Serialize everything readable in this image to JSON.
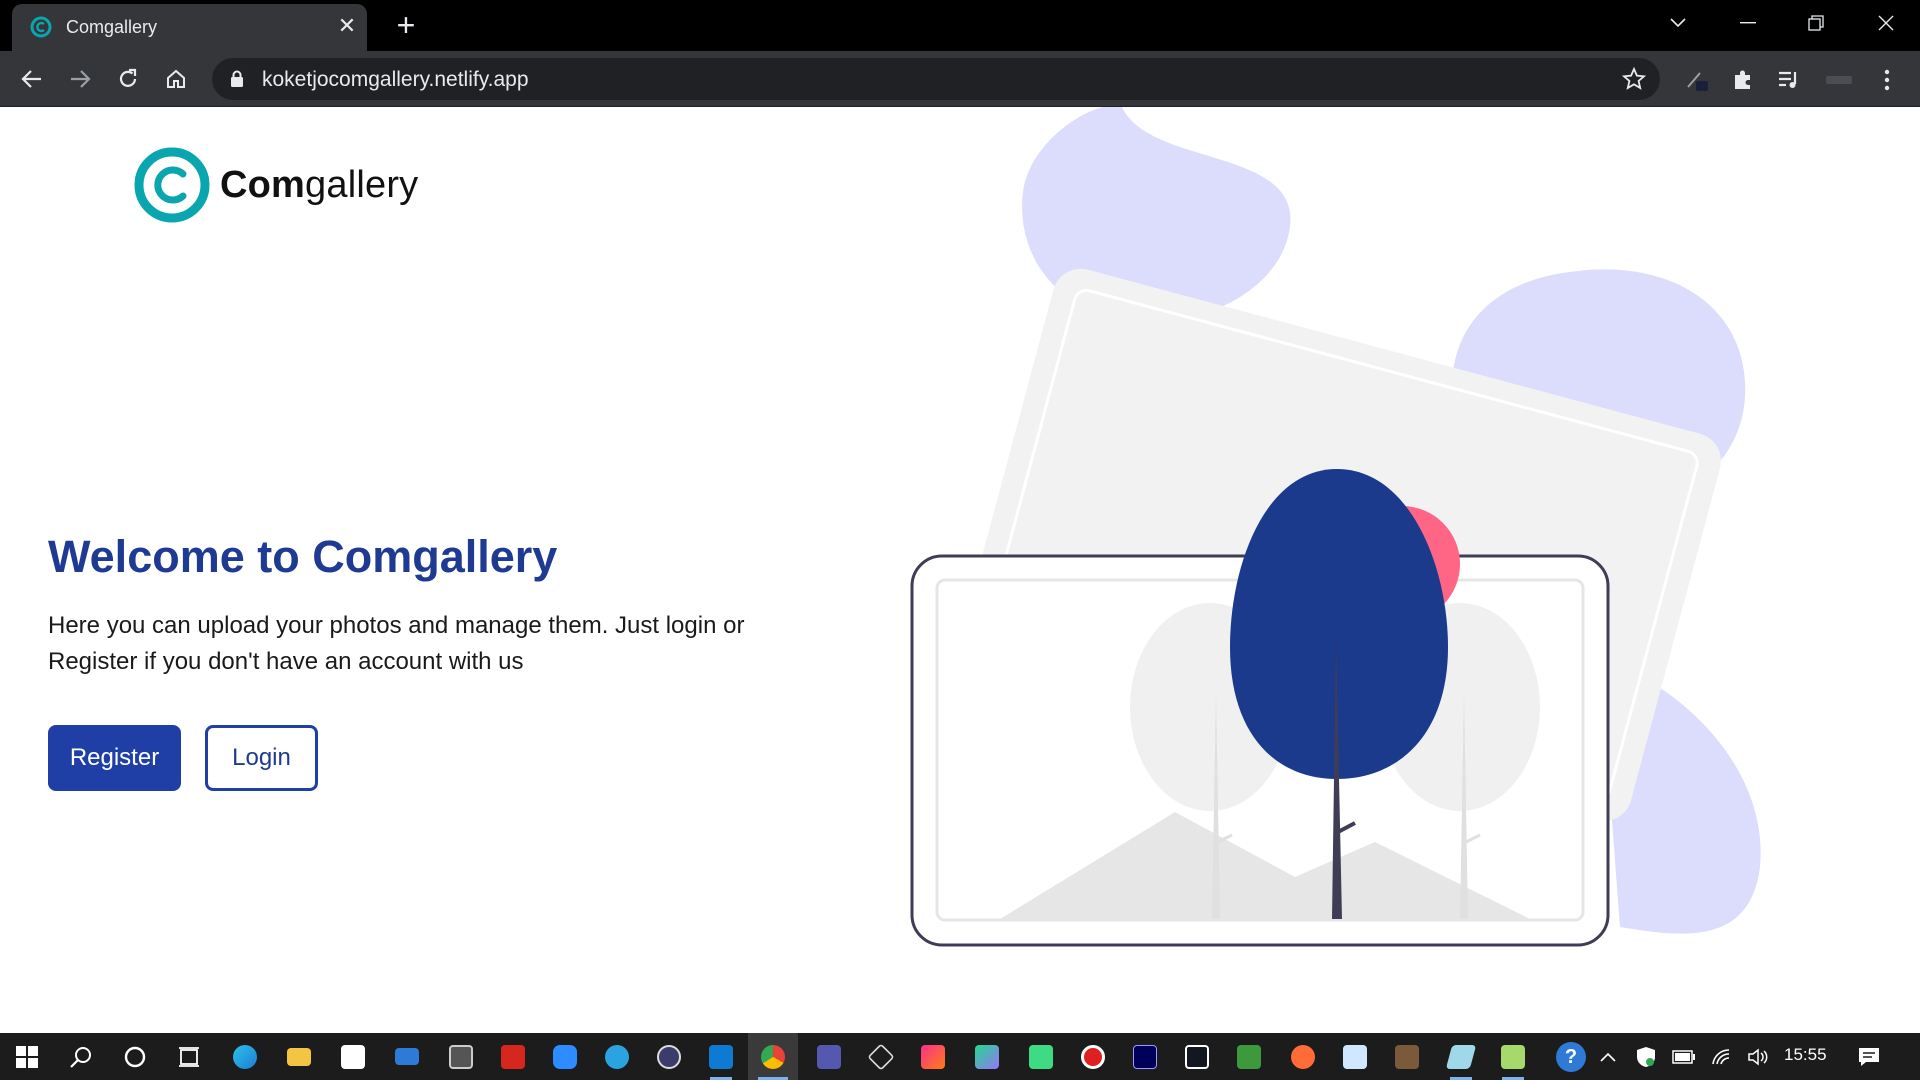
{
  "browser": {
    "tab_title": "Comgallery",
    "url": "koketjocomgallery.netlify.app"
  },
  "brand": {
    "logo_text_bold": "Com",
    "logo_text_rest": "gallery",
    "color_primary": "#1f3a93",
    "color_accent": "#0aa6b0"
  },
  "hero": {
    "title": "Welcome to Comgallery",
    "description": "Here you can upload your photos and manage them. Just login or Register if you don't have an account with us",
    "register_label": "Register",
    "login_label": "Login"
  },
  "taskbar": {
    "time": "15:55",
    "apps": [
      "start-icon",
      "search-icon",
      "cortana-icon",
      "task-view-icon",
      "edge-icon",
      "file-explorer-icon",
      "store-icon",
      "mail-icon",
      "media-icon",
      "acrobat-icon",
      "zoom-icon",
      "telegram-icon",
      "terminal-icon",
      "vscode-icon",
      "chrome-icon",
      "teams-icon",
      "virtualbox-icon",
      "intellij-icon",
      "datagrip-icon",
      "android-studio-icon",
      "recorder-icon",
      "premiere-icon",
      "tradingview-icon",
      "network-tool-icon",
      "postman-icon",
      "snowflake-app-icon",
      "photo-app-icon",
      "notes-icon",
      "notepad-icon"
    ]
  }
}
